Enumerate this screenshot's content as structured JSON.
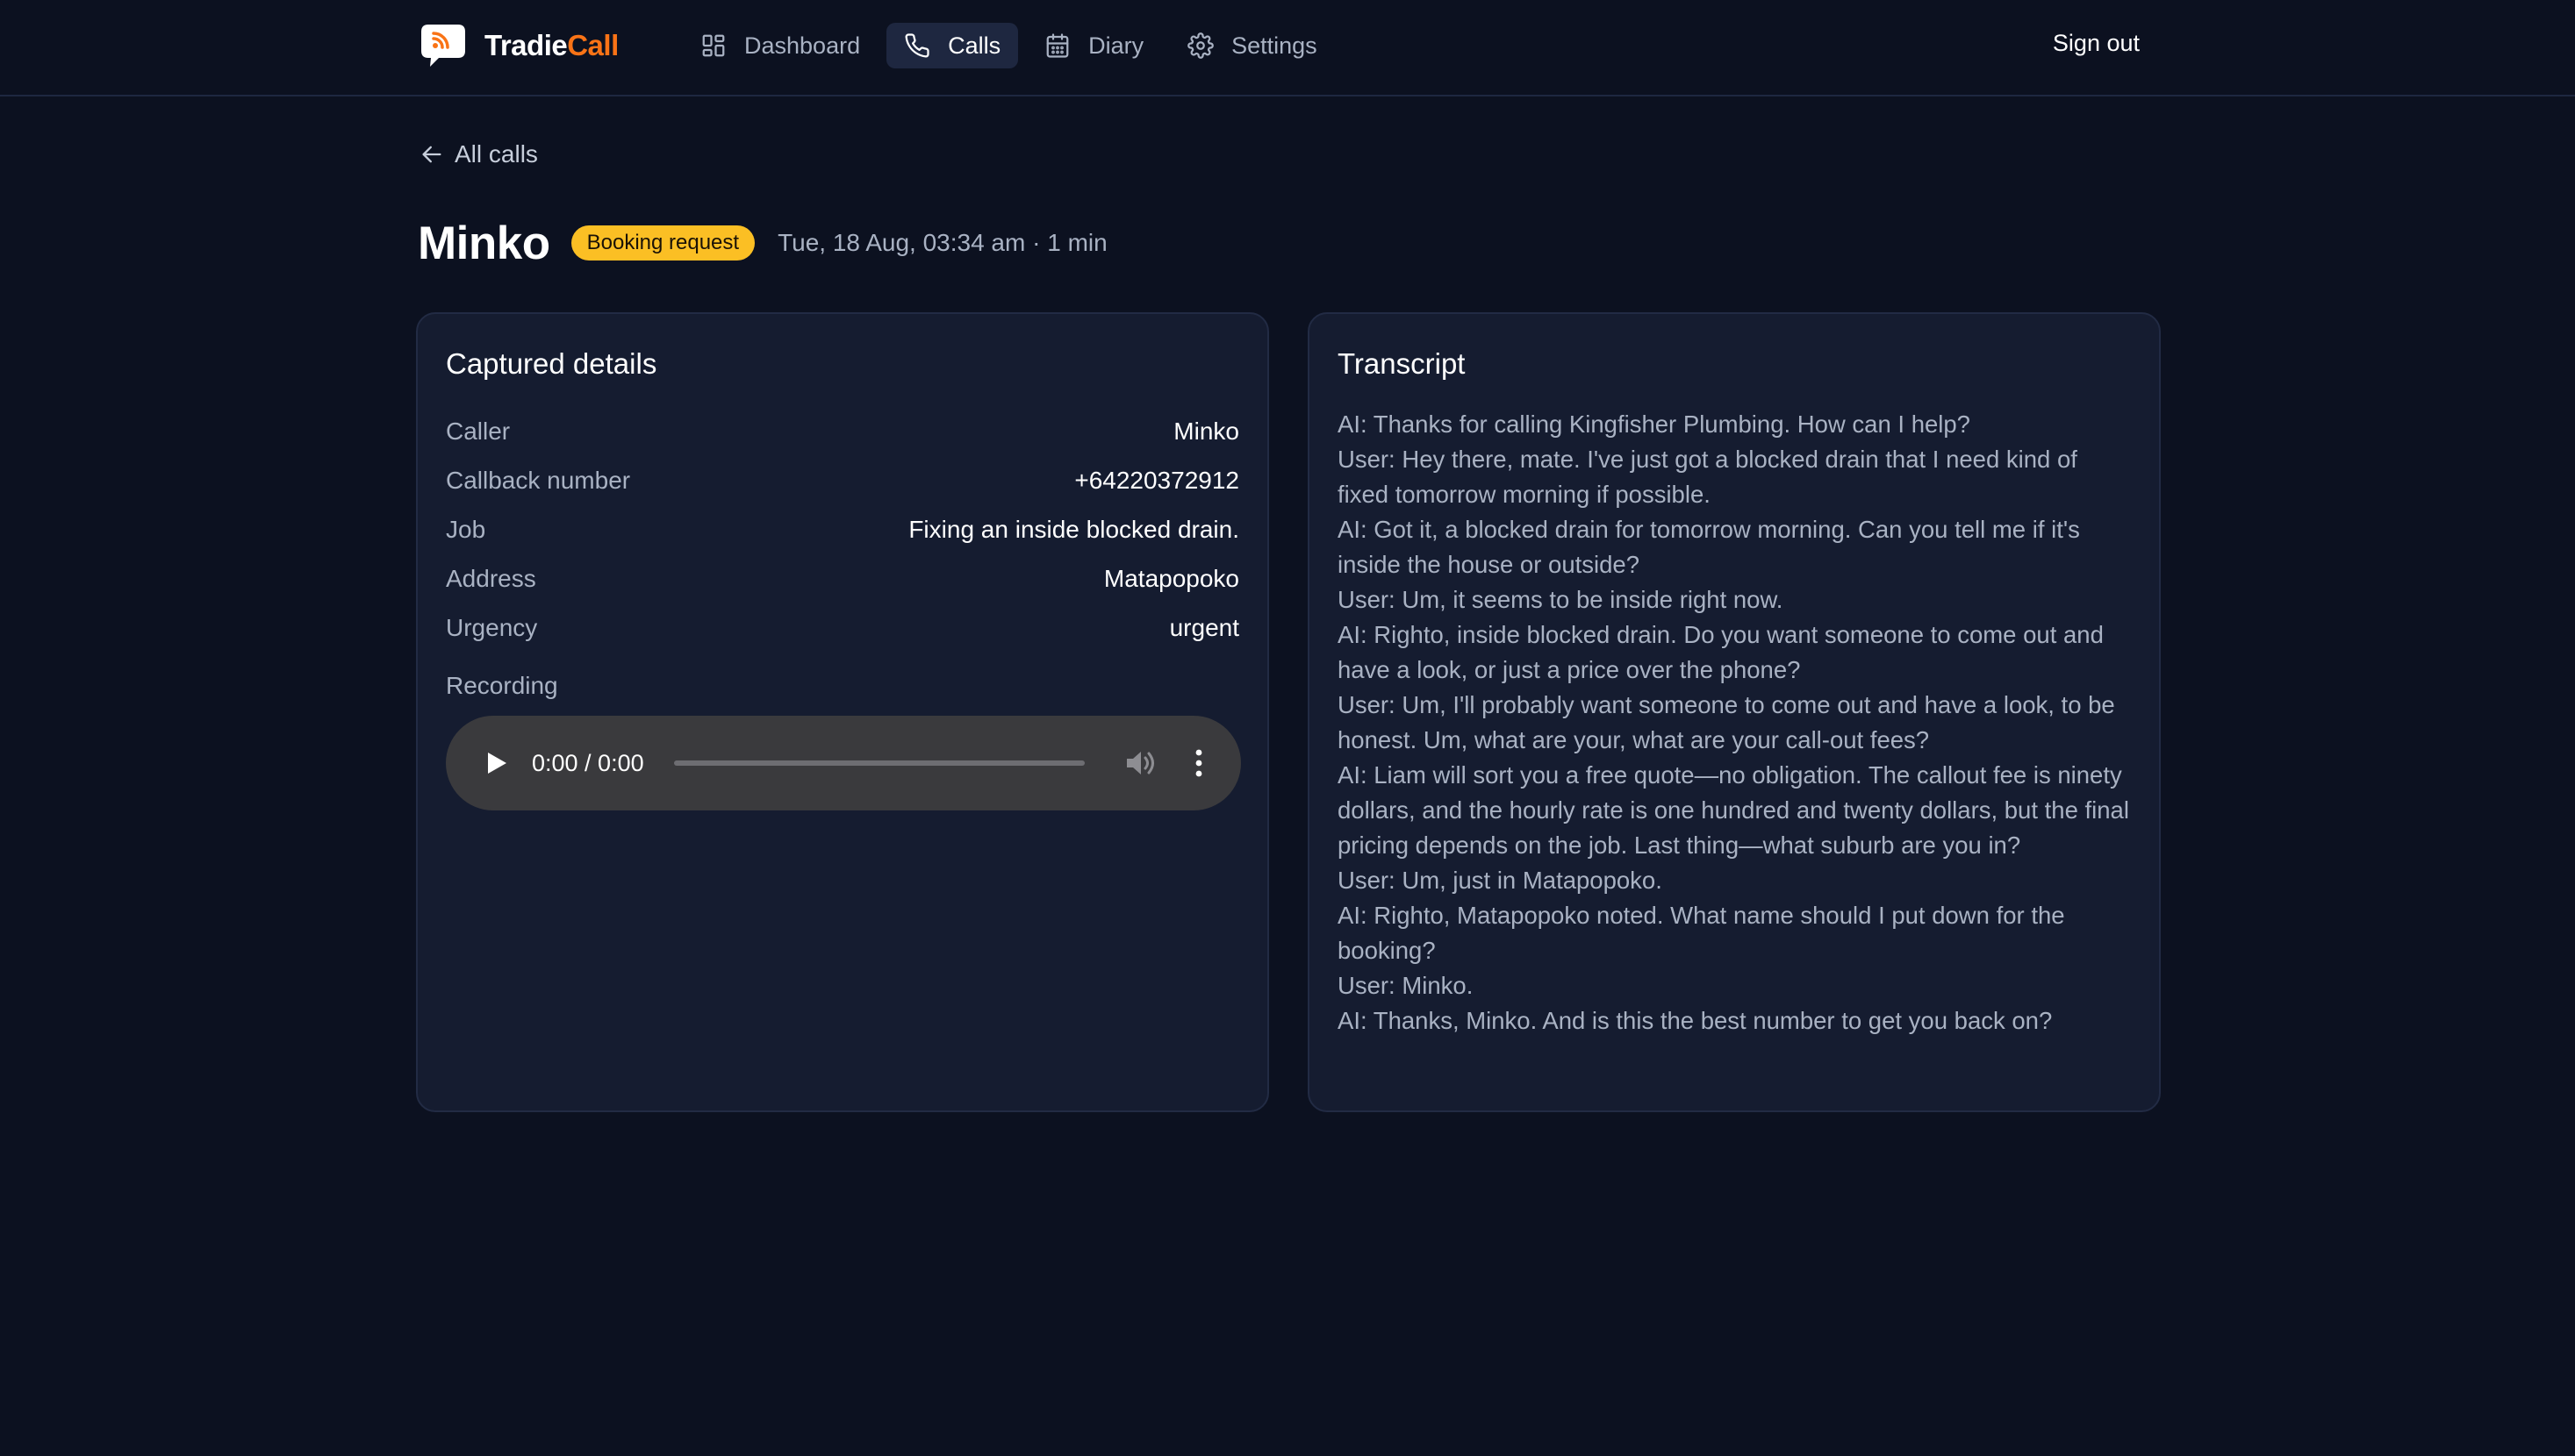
{
  "brand": {
    "name_main": "Tradie",
    "name_accent": "Call",
    "logo_icon": "speech-bubble-wifi-icon",
    "accent_color": "#f97316"
  },
  "nav": {
    "items": [
      {
        "label": "Dashboard",
        "icon": "grid-icon",
        "active": false
      },
      {
        "label": "Calls",
        "icon": "phone-icon",
        "active": true
      },
      {
        "label": "Diary",
        "icon": "calendar-icon",
        "active": false
      },
      {
        "label": "Settings",
        "icon": "gear-icon",
        "active": false
      }
    ],
    "sign_out": "Sign out"
  },
  "back_link": {
    "label": "All calls",
    "icon": "arrow-left-icon"
  },
  "call": {
    "name": "Minko",
    "badge": "Booking request",
    "badge_color": "#fbbf24",
    "meta": "Tue, 18 Aug, 03:34 am · 1 min"
  },
  "details": {
    "title": "Captured details",
    "rows": [
      {
        "label": "Caller",
        "value": "Minko"
      },
      {
        "label": "Callback number",
        "value": "+64220372912"
      },
      {
        "label": "Job",
        "value": "Fixing an inside blocked drain."
      },
      {
        "label": "Address",
        "value": "Matapopoko"
      },
      {
        "label": "Urgency",
        "value": "urgent"
      }
    ],
    "recording_label": "Recording",
    "player": {
      "time": "0:00 / 0:00",
      "progress": 0
    }
  },
  "transcript": {
    "title": "Transcript",
    "lines": [
      "AI: Thanks for calling Kingfisher Plumbing. How can I help?",
      "User: Hey there, mate. I've just got a blocked drain that I need kind of fixed tomorrow morning if possible.",
      "AI: Got it, a blocked drain for tomorrow morning. Can you tell me if it's inside the house or outside?",
      "User: Um, it seems to be inside right now.",
      "AI: Righto, inside blocked drain. Do you want someone to come out and have a look, or just a price over the phone?",
      "User: Um, I'll probably want someone to come out and have a look, to be honest. Um, what are your, what are your call-out fees?",
      "AI: Liam will sort you a free quote—no obligation. The callout fee is ninety dollars, and the hourly rate is one hundred and twenty dollars, but the final pricing depends on the job. Last thing—what suburb are you in?",
      "User: Um, just in Matapopoko.",
      "AI: Righto, Matapopoko noted. What name should I put down for the booking?",
      "User: Minko.",
      "AI: Thanks, Minko. And is this the best number to get you back on?"
    ]
  }
}
